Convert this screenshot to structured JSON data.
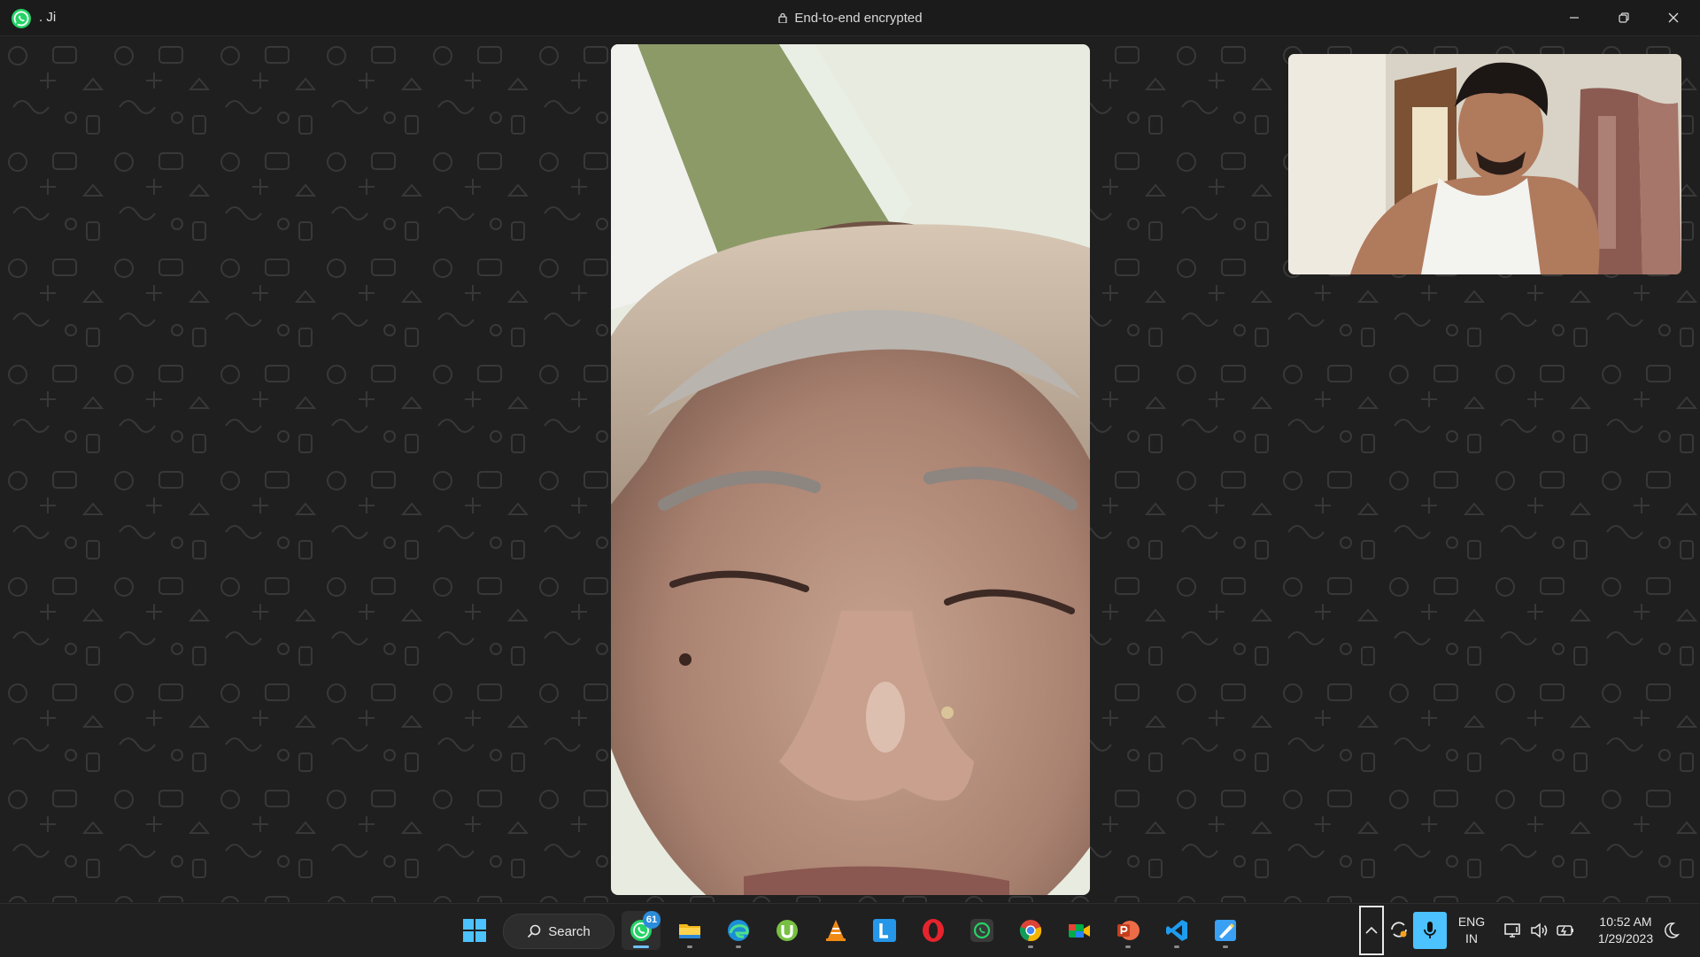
{
  "window": {
    "contact_name": ". Ji",
    "encryption_label": "End-to-end encrypted"
  },
  "taskbar": {
    "search_label": "Search",
    "whatsapp_badge": "61",
    "apps": [
      "start-icon",
      "whatsapp-icon",
      "file-explorer-icon",
      "edge-icon",
      "utorrent-icon",
      "vlc-icon",
      "l-app-icon",
      "opera-icon",
      "whatsapp-alt-icon",
      "chrome-icon",
      "meet-icon",
      "powerpoint-icon",
      "vscode-icon",
      "paint-icon"
    ],
    "tray": {
      "lang_line1": "ENG",
      "lang_line2": "IN",
      "time": "10:52 AM",
      "date": "1/29/2023"
    }
  },
  "colors": {
    "titlebar": "#1b1b1b",
    "background": "#1f1f1f",
    "taskbar": "#202020",
    "accent": "#6ec1ff",
    "whatsapp_green": "#25d366",
    "badge": "#2b8cdb"
  }
}
